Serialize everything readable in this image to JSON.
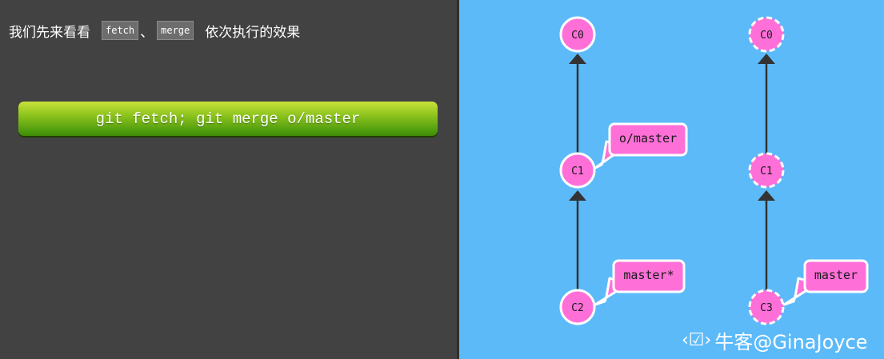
{
  "intro": {
    "prefix": "我们先来看看",
    "code1": "fetch",
    "separator": "、",
    "code2": "merge",
    "suffix": "依次执行的效果"
  },
  "command_button": {
    "label": "git fetch; git merge o/master"
  },
  "graph_before": {
    "commits": [
      "C0",
      "C1",
      "C2"
    ],
    "branch_labels": [
      "o/master",
      "master*"
    ]
  },
  "graph_after": {
    "commits": [
      "C0",
      "C1",
      "C3"
    ],
    "branch_labels": [
      "master"
    ]
  },
  "watermark": {
    "icon": "niuke-logo-icon",
    "text": "牛客@GinaJoyce"
  },
  "colors": {
    "left_bg": "#424242",
    "right_bg": "#5cbaf9",
    "commit_fill": "#ff6fd8",
    "branch_fill": "#ff6fd8",
    "edge": "#333333",
    "button_green": "#7ab818"
  }
}
